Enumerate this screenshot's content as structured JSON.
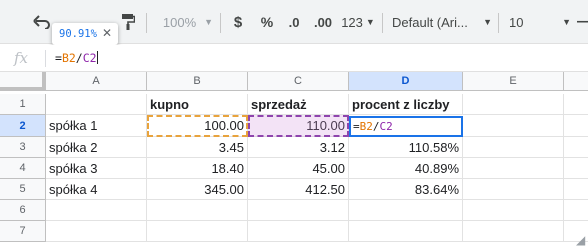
{
  "toolbar": {
    "zoom": "100%",
    "currency": "$",
    "percent": "%",
    "decrease_decimal": ".0",
    "increase_decimal": ".00",
    "more_formats": "123",
    "font": "Default (Ari...",
    "font_size": "10"
  },
  "tooltip": {
    "value": "90.91%"
  },
  "formula_bar": {
    "fx": "fx",
    "prefix": "=",
    "ref1": "B2",
    "operator": "/",
    "ref2": "C2"
  },
  "columns": [
    "A",
    "B",
    "C",
    "D",
    "E"
  ],
  "rows": [
    {
      "num": "1",
      "a": "",
      "b": "kupno",
      "c": "sprzedaż",
      "d": "procent z liczby"
    },
    {
      "num": "2",
      "a": "spółka 1",
      "b": "100.00",
      "c": "110.00",
      "d": "=B2/C2"
    },
    {
      "num": "3",
      "a": "spółka 2",
      "b": "3.45",
      "c": "3.12",
      "d": "110.58%"
    },
    {
      "num": "4",
      "a": "spółka 3",
      "b": "18.40",
      "c": "45.00",
      "d": "40.89%"
    },
    {
      "num": "5",
      "a": "spółka 4",
      "b": "345.00",
      "c": "412.50",
      "d": "83.64%"
    },
    {
      "num": "6",
      "a": "",
      "b": "",
      "c": "",
      "d": ""
    },
    {
      "num": "7",
      "a": "",
      "b": "",
      "c": "",
      "d": ""
    }
  ],
  "colors": {
    "ref_b": "#e37400",
    "ref_c": "#8e24aa",
    "active": "#1a73e8"
  }
}
